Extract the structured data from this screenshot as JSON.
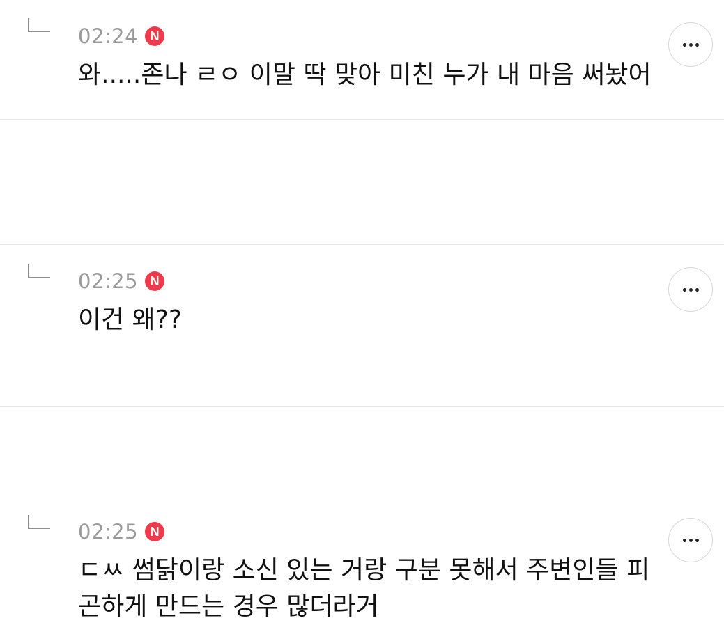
{
  "comments": [
    {
      "time": "02:24",
      "badge": "N",
      "text": "와.....존나 ㄹㅇ 이말 딱 맞아 미친 누가 내 마음 써놨어"
    },
    {
      "time": "02:25",
      "badge": "N",
      "text": "이건 왜??"
    },
    {
      "time": "02:25",
      "badge": "N",
      "text": "ㄷㅆ 썸닭이랑 소신 있는 거랑 구분 못해서 주변인들 피곤하게 만드는 경우 많더라거"
    }
  ]
}
